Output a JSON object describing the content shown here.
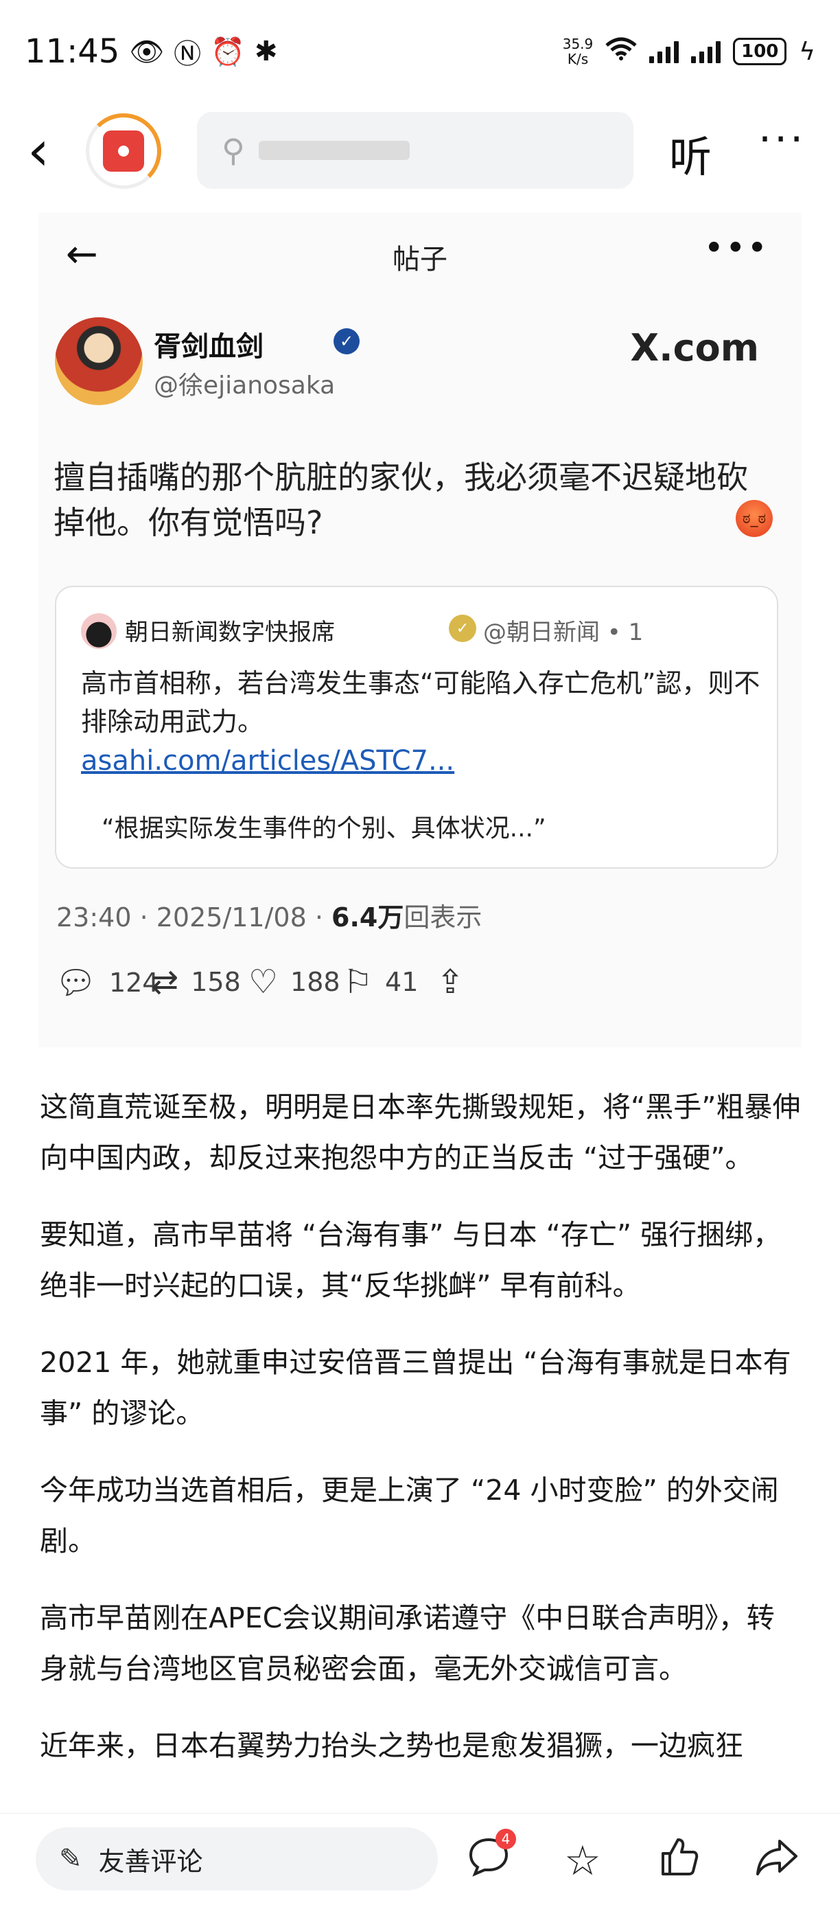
{
  "status_bar": {
    "time": "11:45",
    "net_speed_value": "35.9",
    "net_speed_unit": "K/s",
    "battery": "100"
  },
  "top_nav": {
    "search_placeholder": "",
    "listen_label": "听",
    "more_label": "···"
  },
  "post_card": {
    "header_title": "帖子",
    "author_name": "胥剑血剑",
    "author_handle": "@徐ejianosaka",
    "platform": "X.com",
    "tweet_text": "擅自插嘴的那个肮脏的家伙，我必须毫不迟疑地砍掉他。你有觉悟吗?",
    "quote": {
      "source_name": "朝日新闻数字快报席",
      "source_handle": "@朝日新闻 • 1",
      "text": "高市首相称，若台湾发生事态“可能陷入存亡危机”認，则不排除动用武力。",
      "link": "asahi.com/articles/ASTC7...",
      "excerpt": "“根据实际发生事件的个别、具体状况...”"
    },
    "meta_time": "23:40 · 2025/11/08 · ",
    "meta_views": "6.4万",
    "meta_views_suffix": "回表示",
    "actions": {
      "replies": "124",
      "reposts": "158",
      "likes": "188",
      "bookmarks": "41"
    }
  },
  "article": {
    "paragraphs": [
      "这简直荒诞至极，明明是日本率先撕毁规矩，将“黑手”粗暴伸向中国内政，却反过来抱怨中方的正当反击 “过于强硬”。",
      "要知道，高市早苗将 “台海有事” 与日本 “存亡” 强行捆绑，绝非一时兴起的口误，其“反华挑衅” 早有前科。",
      "2021 年，她就重申过安倍晋三曾提出 “台海有事就是日本有事” 的谬论。",
      "今年成功当选首相后，更是上演了 “24 小时变脸” 的外交闹剧。",
      "高市早苗刚在APEC会议期间承诺遵守《中日联合声明》，转身就与台湾地区官员秘密会面，毫无外交诚信可言。",
      "近年来，日本右翼势力抬头之势也是愈发猖獗，一边疯狂"
    ]
  },
  "bottom_bar": {
    "comment_placeholder": "友善评论",
    "comment_badge": "4"
  }
}
